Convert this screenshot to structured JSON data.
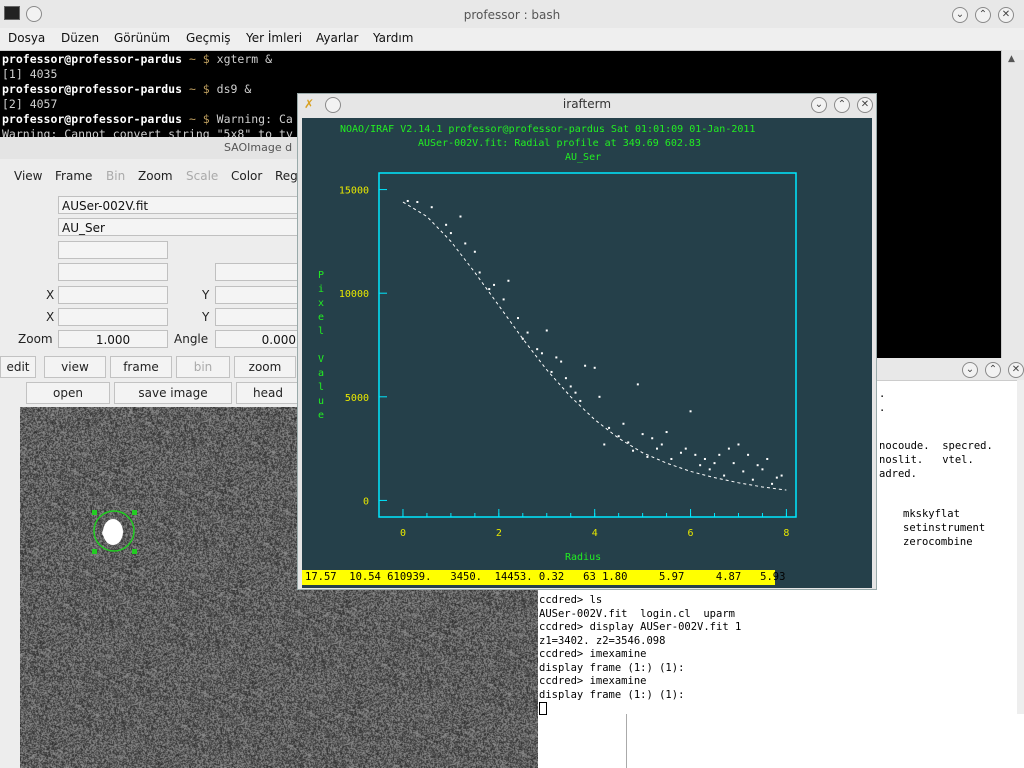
{
  "term_main": {
    "title": "professor : bash",
    "menu": [
      "Dosya",
      "Düzen",
      "Görünüm",
      "Geçmiş",
      "Yer İmleri",
      "Ayarlar",
      "Yardım"
    ],
    "lines": [
      {
        "user": "professor@professor-pardus",
        "path": " ~ $ ",
        "cmd": "xgterm &"
      },
      {
        "text": "[1] 4035"
      },
      {
        "user": "professor@professor-pardus",
        "path": " ~ $ ",
        "cmd": "ds9 &"
      },
      {
        "text": "[2] 4057"
      },
      {
        "user": "professor@professor-pardus",
        "path": " ~ $ ",
        "cmd": "Warning: Ca"
      },
      {
        "text": "Warning: Cannot convert string \"5x8\" to ty"
      }
    ]
  },
  "ds9": {
    "title": "SAOImage d",
    "menu": [
      {
        "label": "View",
        "enabled": true
      },
      {
        "label": "Frame",
        "enabled": true
      },
      {
        "label": "Bin",
        "enabled": false
      },
      {
        "label": "Zoom",
        "enabled": true
      },
      {
        "label": "Scale",
        "enabled": false
      },
      {
        "label": "Color",
        "enabled": true
      },
      {
        "label": "Reg",
        "enabled": true
      }
    ],
    "file": "AUSer-002V.fit",
    "object": "AU_Ser",
    "x_label": "X",
    "y_label": "Y",
    "zoom_label": "Zoom",
    "zoom_value": "1.000",
    "angle_label": "Angle",
    "angle_value": "0.000",
    "buttons_row1": [
      {
        "label": "edit",
        "enabled": true
      },
      {
        "label": "view",
        "enabled": true
      },
      {
        "label": "frame",
        "enabled": true
      },
      {
        "label": "bin",
        "enabled": false
      },
      {
        "label": "zoom",
        "enabled": true
      }
    ],
    "buttons_row2": [
      {
        "label": "open",
        "enabled": true
      },
      {
        "label": "save image",
        "enabled": true
      },
      {
        "label": "head",
        "enabled": true
      }
    ]
  },
  "iraf": {
    "title": "irafterm",
    "header1": "NOAO/IRAF V2.14.1 professor@professor-pardus Sat 01:01:09 01-Jan-2011",
    "header2": "AUSer-002V.fit: Radial profile at 349.69 602.83",
    "header3": "AU_Ser",
    "status": "17.57  10.54 610939.   3450.  14453. 0.32   63 1.80     5.97     4.87   5.93"
  },
  "chart_data": {
    "type": "scatter",
    "title": "AU_Ser",
    "xlabel": "Radius",
    "ylabel": "Pixel Value",
    "xlim": [
      -0.5,
      8.2
    ],
    "ylim": [
      -800,
      15800
    ],
    "xticks": [
      "0",
      "2",
      "4",
      "6",
      "8"
    ],
    "yticks": [
      "0",
      "5000",
      "10000",
      "15000"
    ],
    "series": [
      {
        "kind": "points",
        "values": [
          [
            0.1,
            14450
          ],
          [
            0.3,
            14400
          ],
          [
            0.6,
            14150
          ],
          [
            0.9,
            13300
          ],
          [
            1.0,
            12900
          ],
          [
            1.2,
            13700
          ],
          [
            1.3,
            12400
          ],
          [
            1.5,
            12000
          ],
          [
            1.6,
            11000
          ],
          [
            1.8,
            10200
          ],
          [
            1.9,
            10400
          ],
          [
            2.1,
            9700
          ],
          [
            2.2,
            10600
          ],
          [
            2.4,
            8800
          ],
          [
            2.5,
            7800
          ],
          [
            2.6,
            8100
          ],
          [
            2.8,
            7300
          ],
          [
            2.9,
            7100
          ],
          [
            3.0,
            8200
          ],
          [
            3.1,
            6200
          ],
          [
            3.2,
            6900
          ],
          [
            3.3,
            6700
          ],
          [
            3.4,
            5900
          ],
          [
            3.5,
            5500
          ],
          [
            3.6,
            5200
          ],
          [
            3.7,
            4800
          ],
          [
            3.8,
            6500
          ],
          [
            4.0,
            6400
          ],
          [
            4.1,
            5000
          ],
          [
            4.2,
            2700
          ],
          [
            4.3,
            3500
          ],
          [
            4.5,
            3100
          ],
          [
            4.6,
            3700
          ],
          [
            4.7,
            2800
          ],
          [
            4.8,
            2400
          ],
          [
            4.9,
            5600
          ],
          [
            5.0,
            3200
          ],
          [
            5.1,
            2100
          ],
          [
            5.2,
            3000
          ],
          [
            5.3,
            2500
          ],
          [
            5.4,
            2700
          ],
          [
            5.5,
            3300
          ],
          [
            5.6,
            2000
          ],
          [
            5.8,
            2300
          ],
          [
            5.9,
            2500
          ],
          [
            6.0,
            4300
          ],
          [
            6.1,
            2200
          ],
          [
            6.2,
            1700
          ],
          [
            6.3,
            2000
          ],
          [
            6.4,
            1500
          ],
          [
            6.5,
            1800
          ],
          [
            6.6,
            2200
          ],
          [
            6.7,
            1200
          ],
          [
            6.8,
            2500
          ],
          [
            6.9,
            1800
          ],
          [
            7.0,
            2700
          ],
          [
            7.1,
            1400
          ],
          [
            7.2,
            2200
          ],
          [
            7.3,
            1000
          ],
          [
            7.4,
            1700
          ],
          [
            7.5,
            1500
          ],
          [
            7.6,
            2000
          ],
          [
            7.7,
            800
          ],
          [
            7.8,
            1100
          ],
          [
            7.9,
            1200
          ]
        ]
      },
      {
        "kind": "fit",
        "values": [
          [
            0.0,
            14400
          ],
          [
            0.5,
            13700
          ],
          [
            1.0,
            12500
          ],
          [
            1.5,
            11000
          ],
          [
            2.0,
            9400
          ],
          [
            2.5,
            7800
          ],
          [
            3.0,
            6300
          ],
          [
            3.5,
            5000
          ],
          [
            4.0,
            3900
          ],
          [
            4.5,
            3000
          ],
          [
            5.0,
            2300
          ],
          [
            5.5,
            1800
          ],
          [
            6.0,
            1400
          ],
          [
            6.5,
            1100
          ],
          [
            7.0,
            850
          ],
          [
            7.5,
            650
          ],
          [
            8.0,
            500
          ]
        ]
      }
    ]
  },
  "xterm2": {
    "frag_right": [
      "nocoude.  specred.",
      "noslit.   vtel.",
      "adred."
    ],
    "frag_right2": [
      "mkskyflat",
      "setinstrument",
      "zerocombine"
    ],
    "lines": [
      "ccdred> ls",
      "AUSer-002V.fit  login.cl  uparm",
      "ccdred> display AUSer-002V.fit 1",
      "z1=3402. z2=3546.098",
      "ccdred> imexamine",
      "display frame (1:) (1):",
      "ccdred> imexamine",
      "display frame (1:) (1):"
    ]
  }
}
